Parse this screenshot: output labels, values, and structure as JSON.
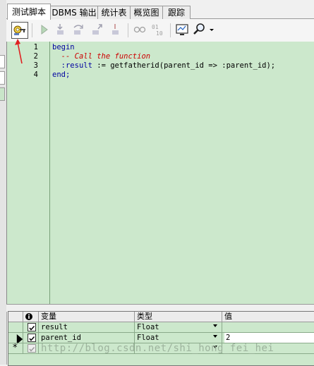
{
  "tabs": [
    "测试脚本",
    "DBMS 输出",
    "统计表",
    "概览图",
    "跟踪"
  ],
  "editor": {
    "line_numbers": [
      "1",
      "2",
      "3",
      "4"
    ],
    "line1": {
      "kw": "begin"
    },
    "line2": {
      "comment": "-- Call the function"
    },
    "line3": {
      "var": ":result",
      "rest": " := getfatherid(parent_id => :parent_id);"
    },
    "line4": {
      "kw": "end;"
    }
  },
  "grid": {
    "headers": {
      "variable": "变量",
      "type": "类型",
      "value": "值"
    },
    "rows": [
      {
        "name": "result",
        "type": "Float",
        "value": "",
        "checked": true
      },
      {
        "name": "parent_id",
        "type": "Float",
        "value": "2",
        "checked": true,
        "current": true
      },
      {
        "name": "",
        "type": "",
        "value": "",
        "new_row": true
      }
    ]
  },
  "watermark": "http://blog.csdn.net/shi_hong_fei_hei",
  "colors": {
    "editor_bg": "#cce8cc",
    "keyword": "#0000a0",
    "comment": "#cc0000",
    "arrow": "#e02020"
  }
}
